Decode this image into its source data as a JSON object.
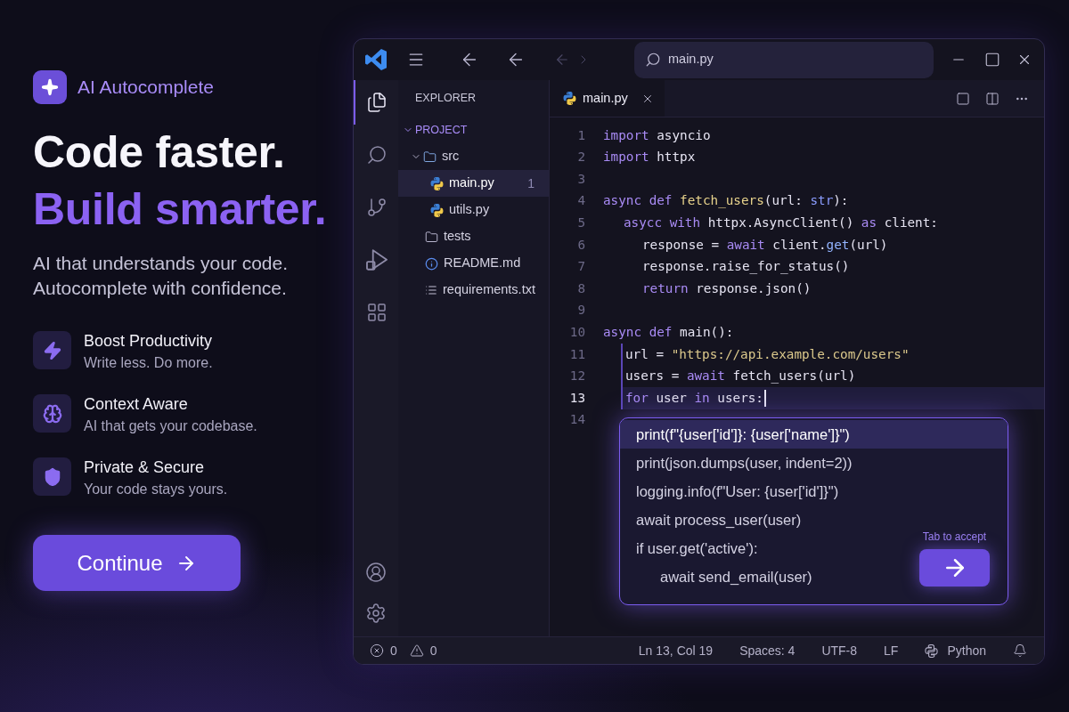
{
  "promo": {
    "brand": "AI Autocomplete",
    "headline": [
      {
        "text": "Code faster.",
        "accent": false
      },
      {
        "text": "Build smarter.",
        "accent": true
      }
    ],
    "subtitle": [
      "AI that understands your code.",
      "Autocomplete with confidence."
    ],
    "features": [
      {
        "kind": "bolt",
        "title": "Boost Productivity",
        "description": "Write less. Do more."
      },
      {
        "kind": "brain",
        "title": "Context Aware",
        "description": "AI that gets your codebase."
      },
      {
        "kind": "shield",
        "title": "Private & Secure",
        "description": "Your code stays yours."
      }
    ],
    "cta": "Continue"
  },
  "editor": {
    "title_bar": {
      "nav": [
        {
          "kind": "back",
          "disabled": false
        },
        {
          "kind": "back",
          "disabled": false
        },
        {
          "kind": "back",
          "disabled": true
        },
        {
          "kind": "forward",
          "disabled": true
        }
      ],
      "search": {
        "value": "main.py"
      }
    },
    "activity_bar": [
      {
        "kind": "files",
        "selected": true
      },
      {
        "kind": "search",
        "selected": false
      },
      {
        "kind": "source_control",
        "selected": false
      },
      {
        "kind": "run",
        "selected": false
      },
      {
        "kind": "extensions",
        "selected": false
      }
    ],
    "activity_bar_bottom": [
      {
        "kind": "account"
      },
      {
        "kind": "settings"
      }
    ],
    "explorer": {
      "title": "EXPLORER",
      "tree": [
        {
          "label": "PROJECT",
          "kind": "root",
          "expanded": true,
          "children": [
            {
              "label": "src",
              "kind": "folder",
              "expanded": true,
              "selected": false,
              "children": [
                {
                  "label": "main.py",
                  "kind": "python",
                  "selected": true,
                  "badge": "1"
                },
                {
                  "label": "utils.py",
                  "kind": "python",
                  "selected": false
                }
              ]
            },
            {
              "label": "tests",
              "kind": "folder",
              "selected": false
            },
            {
              "label": "README.md",
              "kind": "info",
              "selected": false
            },
            {
              "label": "requirements.txt",
              "kind": "list",
              "selected": false
            }
          ]
        }
      ]
    },
    "tabs": [
      {
        "label": "main.py",
        "kind": "python",
        "selected": true
      }
    ],
    "code": {
      "lines": [
        {
          "number": "1",
          "active": false,
          "tokens": [
            {
              "text": "import",
              "kind": "keyword"
            },
            {
              "text": " asyncio",
              "kind": "plain"
            }
          ]
        },
        {
          "number": "2",
          "active": false,
          "tokens": [
            {
              "text": "import",
              "kind": "keyword"
            },
            {
              "text": " httpx",
              "kind": "plain"
            }
          ]
        },
        {
          "number": "3",
          "active": false
        },
        {
          "number": "4",
          "active": false,
          "tokens": [
            {
              "text": "async",
              "kind": "keyword"
            },
            {
              "text": " def",
              "kind": "keyword"
            },
            {
              "text": " fetch_users",
              "kind": "function"
            },
            {
              "text": "(url: ",
              "kind": "plain"
            },
            {
              "text": "str",
              "kind": "type"
            },
            {
              "text": "):",
              "kind": "plain"
            }
          ],
          "children": [
            {
              "number": "5",
              "active": false,
              "tokens": [
                {
                  "text": "asycc",
                  "kind": "keyword"
                },
                {
                  "text": " with",
                  "kind": "keyword"
                },
                {
                  "text": " httpx.AsyncClient()",
                  "kind": "plain"
                },
                {
                  "text": " as",
                  "kind": "keyword"
                },
                {
                  "text": " client:",
                  "kind": "plain"
                }
              ],
              "children": [
                {
                  "number": "6",
                  "active": false,
                  "tokens": [
                    {
                      "text": "response = ",
                      "kind": "plain"
                    },
                    {
                      "text": "await",
                      "kind": "keyword"
                    },
                    {
                      "text": " client.",
                      "kind": "plain"
                    },
                    {
                      "text": "get",
                      "kind": "method"
                    },
                    {
                      "text": "(url)",
                      "kind": "plain"
                    }
                  ]
                },
                {
                  "number": "7",
                  "active": false,
                  "tokens": [
                    {
                      "text": "response.raise_for_status()",
                      "kind": "plain"
                    }
                  ]
                },
                {
                  "number": "8",
                  "active": false,
                  "tokens": [
                    {
                      "text": "return",
                      "kind": "keyword"
                    },
                    {
                      "text": " response.json()",
                      "kind": "plain"
                    }
                  ]
                }
              ]
            }
          ]
        },
        {
          "number": "9",
          "active": false
        },
        {
          "number": "10",
          "active": false,
          "tokens": [
            {
              "text": "async",
              "kind": "keyword"
            },
            {
              "text": " def",
              "kind": "keyword"
            },
            {
              "text": " main():",
              "kind": "plain"
            }
          ],
          "children": [
            {
              "number": "11",
              "active": false,
              "tokens": [
                {
                  "text": "url = ",
                  "kind": "plain"
                },
                {
                  "text": "\"https://api.example.com/users\"",
                  "kind": "string"
                }
              ]
            },
            {
              "number": "12",
              "active": false,
              "tokens": [
                {
                  "text": "users = ",
                  "kind": "plain"
                },
                {
                  "text": "await",
                  "kind": "keyword"
                },
                {
                  "text": " fetch_users(url)",
                  "kind": "plain"
                }
              ]
            },
            {
              "number": "13",
              "active": true,
              "tokens": [
                {
                  "text": "for",
                  "kind": "keyword"
                },
                {
                  "text": " user ",
                  "kind": "plain"
                },
                {
                  "text": "in",
                  "kind": "keyword"
                },
                {
                  "text": " users:",
                  "kind": "plain"
                }
              ]
            }
          ]
        },
        {
          "number": "14",
          "active": false
        }
      ]
    },
    "suggestions": {
      "items": [
        {
          "text": "print(f\"{user['id']}: {user['name']}\")",
          "selected": true
        },
        {
          "text": "print(json.dumps(user, indent=2))",
          "selected": false
        },
        {
          "text": "logging.info(f\"User: {user['id']}\")",
          "selected": false
        },
        {
          "text": "await process_user(user)",
          "selected": false
        },
        {
          "text": "if user.get('active'):",
          "selected": false,
          "children": [
            {
              "text": "await send_email(user)",
              "selected": false
            }
          ]
        }
      ],
      "hint": "Tab to accept"
    },
    "status_bar": {
      "errors": "0",
      "warnings": "0",
      "items": [
        {
          "kind": "position",
          "label": "Ln 13, Col 19"
        },
        {
          "kind": "indentation",
          "label": "Spaces: 4"
        },
        {
          "kind": "encoding",
          "label": "UTF-8"
        },
        {
          "kind": "eol",
          "label": "LF"
        },
        {
          "kind": "language",
          "label": "Python"
        }
      ]
    }
  }
}
